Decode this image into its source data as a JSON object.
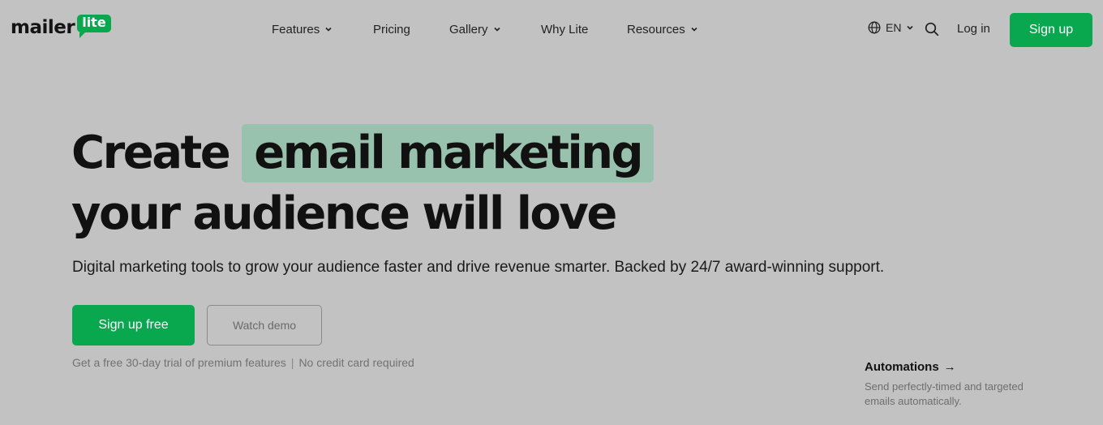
{
  "brand": {
    "wordmark": "mailer",
    "badge": "lite",
    "accent": "#09a84f"
  },
  "nav": {
    "features": "Features",
    "pricing": "Pricing",
    "gallery": "Gallery",
    "why_lite": "Why Lite",
    "resources": "Resources"
  },
  "tools": {
    "language": "EN",
    "login": "Log in",
    "signup": "Sign up"
  },
  "hero": {
    "title_word": "Create",
    "title_highlight": "email marketing",
    "title_line2": "your audience will love",
    "subtitle": "Digital marketing tools to grow your audience faster and drive revenue smarter. Backed by 24/7 award-winning support.",
    "cta_primary": "Sign up free",
    "cta_secondary": "Watch demo",
    "note_left": "Get a free 30-day trial of premium features",
    "note_sep": "|",
    "note_right": "No credit card required",
    "highlight_color": "#99c2ae"
  },
  "feature_card": {
    "title": "Automations",
    "arrow": "→",
    "description": "Send perfectly-timed and targeted emails automatically."
  },
  "icons": [
    "globe-icon",
    "chevron-down-icon",
    "search-icon",
    "arrow-right-icon"
  ]
}
